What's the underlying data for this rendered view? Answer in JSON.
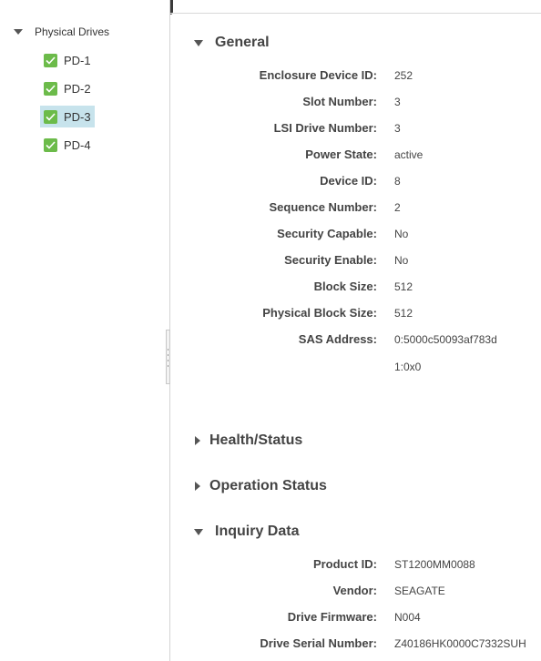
{
  "tree": {
    "root_label": "Physical Drives",
    "items": [
      {
        "label": "PD-1",
        "selected": false
      },
      {
        "label": "PD-2",
        "selected": false
      },
      {
        "label": "PD-3",
        "selected": true
      },
      {
        "label": "PD-4",
        "selected": false
      }
    ]
  },
  "sections": {
    "general": {
      "title": "General",
      "expanded": true,
      "rows": [
        {
          "label": "Enclosure Device ID:",
          "value": "252"
        },
        {
          "label": "Slot Number:",
          "value": "3"
        },
        {
          "label": "LSI Drive Number:",
          "value": "3"
        },
        {
          "label": "Power State:",
          "value": "active"
        },
        {
          "label": "Device ID:",
          "value": "8"
        },
        {
          "label": "Sequence Number:",
          "value": "2"
        },
        {
          "label": "Security Capable:",
          "value": "No"
        },
        {
          "label": "Security Enable:",
          "value": "No"
        },
        {
          "label": "Block Size:",
          "value": "512"
        },
        {
          "label": "Physical Block Size:",
          "value": "512"
        },
        {
          "label": "SAS Address:",
          "value": "0:5000c50093af783d"
        }
      ],
      "sas_address_extra": "1:0x0"
    },
    "health": {
      "title": "Health/Status",
      "expanded": false
    },
    "operation": {
      "title": "Operation Status",
      "expanded": false
    },
    "inquiry": {
      "title": "Inquiry Data",
      "expanded": true,
      "rows": [
        {
          "label": "Product ID:",
          "value": "ST1200MM0088"
        },
        {
          "label": "Vendor:",
          "value": "SEAGATE"
        },
        {
          "label": "Drive Firmware:",
          "value": "N004"
        },
        {
          "label": "Drive Serial Number:",
          "value": "Z40186HK0000C7332SUH"
        }
      ]
    }
  },
  "colors": {
    "check_green": "#6cbb4a",
    "selected_bg": "#c7e3ec",
    "tooltip_bg": "#3a3a3a"
  }
}
